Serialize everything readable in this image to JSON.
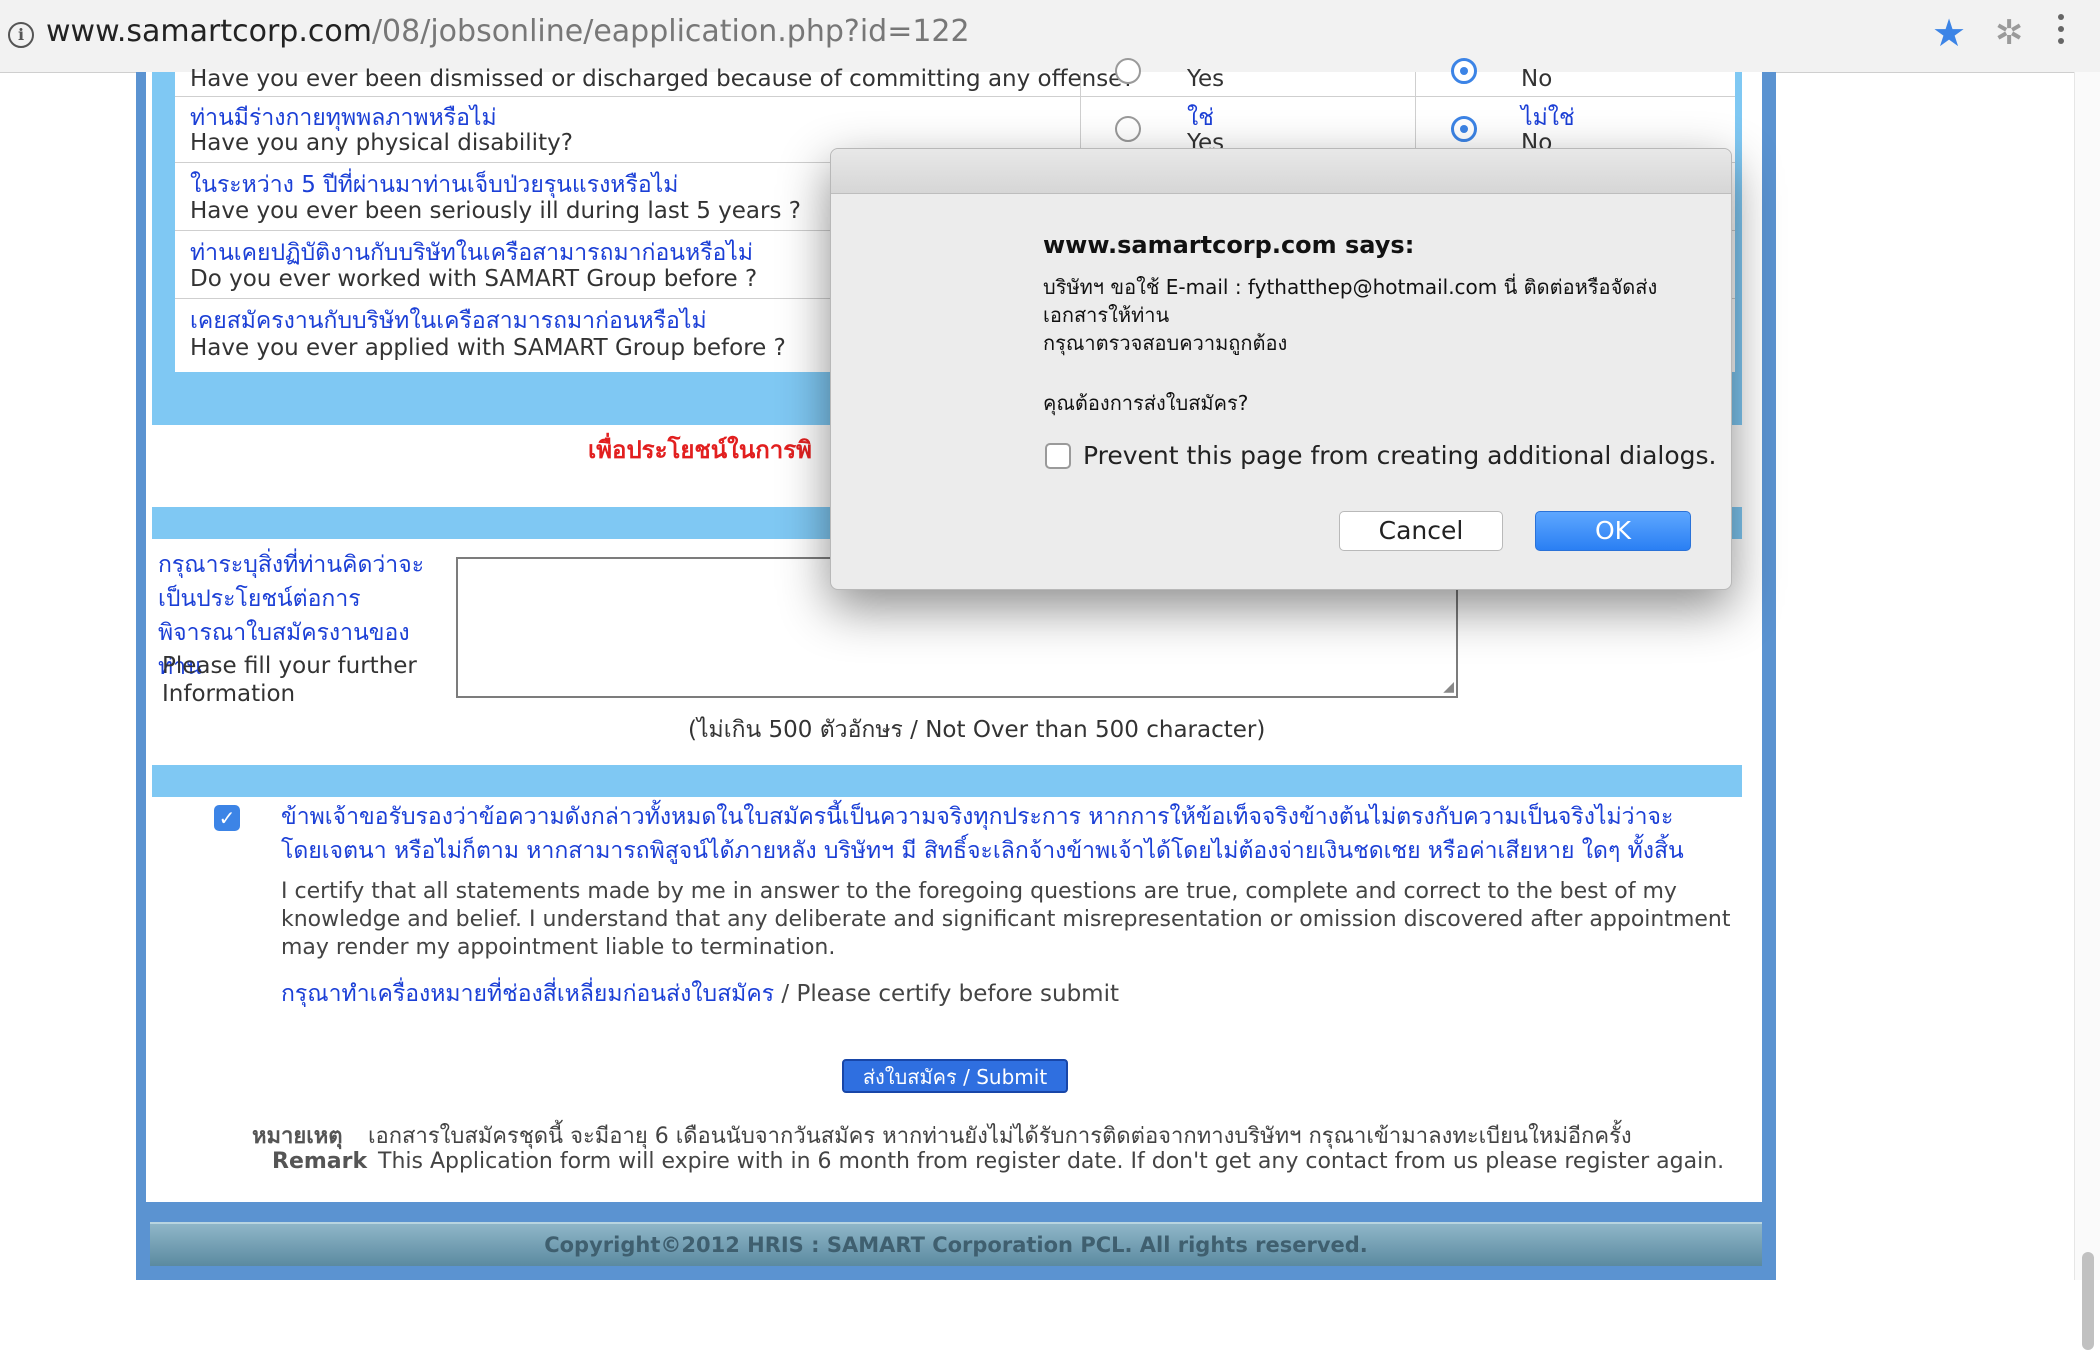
{
  "browser": {
    "url_host": "www.samartcorp.com",
    "url_path": "/08/jobsonline/eapplication.php?id=122",
    "star_icon": "bookmark-star-icon",
    "extension_icon": "extension-icon",
    "menu_icon": "more-vertical-icon"
  },
  "questions": [
    {
      "th": "",
      "en": "Have you ever been dismissed or discharged because of committing any offense?",
      "opt1_th": "",
      "opt1_en": "Yes",
      "opt2_th": "",
      "opt2_en": "No",
      "selected": 2
    },
    {
      "th": "ท่านมีร่างกายทุพพลภาพหรือไม่",
      "en": "Have you any physical disability?",
      "opt1_th": "ใช่",
      "opt1_en": "Yes",
      "opt2_th": "ไม่ใช่",
      "opt2_en": "No",
      "selected": 2
    },
    {
      "th": "ในระหว่าง 5 ปีที่ผ่านมาท่านเจ็บป่วยรุนแรงหรือไม่",
      "en": "Have you ever been seriously ill during last 5 years ?"
    },
    {
      "th": "ท่านเคยปฏิบัติงานกับบริษัทในเครือสามารถมาก่อนหรือไม่",
      "en": "Do you ever worked with SAMART Group before ?"
    },
    {
      "th": "เคยสมัครงานกับบริษัทในเครือสามารถมาก่อนหรือไม่",
      "en": "Have you ever applied with SAMART Group before ?"
    }
  ],
  "benefit_section": {
    "title": "เพื่อประโยชน์ในการพิ",
    "label_th": "กรุณาระบุสิ่งที่ท่านคิดว่าจะเป็นประโยชน์ต่อการพิจารณาใบสมัครงานของท่าน",
    "label_en": "Please fill your further Information",
    "textarea_value": "",
    "char_limit": "(ไม่เกิน 500 ตัวอักษร / Not Over than 500 character)"
  },
  "certify": {
    "checked": true,
    "th": "ข้าพเจ้าขอรับรองว่าข้อความดังกล่าวทั้งหมดในใบสมัครนี้เป็นความจริงทุกประการ หากการให้ข้อเท็จจริงข้างต้นไม่ตรงกับความเป็นจริงไม่ว่าจะโดยเจตนา หรือไม่ก็ตาม หากสามารถพิสูจน์ได้ภายหลัง บริษัทฯ มี สิทธิ์จะเลิกจ้างข้าพเจ้าได้โดยไม่ต้องจ่ายเงินชดเชย หรือค่าเสียหาย ใดๆ ทั้งสิ้น",
    "en": "I certify that all statements made by me in answer to the foregoing questions are true, complete and correct to the best of my knowledge and belief. I understand that any deliberate and significant misrepresentation or omission discovered after appointment may render my appointment liable to termination.",
    "note_th": "กรุณาทำเครื่องหมายที่ช่องสี่เหลี่ยมก่อนส่งใบสมัคร",
    "note_en": " / Please certify before submit"
  },
  "submit_label": "ส่งใบสมัคร / Submit",
  "remark": {
    "th_label": "หมายเหตุ",
    "th_text": "เอกสารใบสมัครชุดนี้ จะมีอายุ 6 เดือนนับจากวันสมัคร หากท่านยังไม่ได้รับการติดต่อจากทางบริษัทฯ กรุณาเข้ามาลงทะเบียนใหม่อีกครั้ง",
    "en_label": "Remark",
    "en_text": "This Application form will expire with in 6 month from register date. If don't get any contact from us please register again."
  },
  "footer": "Copyright©2012 HRIS : SAMART Corporation PCL. All rights reserved.",
  "dialog": {
    "title": "www.samartcorp.com says:",
    "message_lines": [
      "บริษัทฯ ขอใช้ E-mail : fythatthep@hotmail.com นี่ ติดต่อหรือจัดส่งเอกสารให้ท่าน",
      "กรุณาตรวจสอบความถูกต้อง"
    ],
    "question": "คุณต้องการส่งใบสมัคร?",
    "checkbox_label": "Prevent this page from creating additional dialogs.",
    "checkbox_checked": false,
    "cancel_label": "Cancel",
    "ok_label": "OK"
  }
}
